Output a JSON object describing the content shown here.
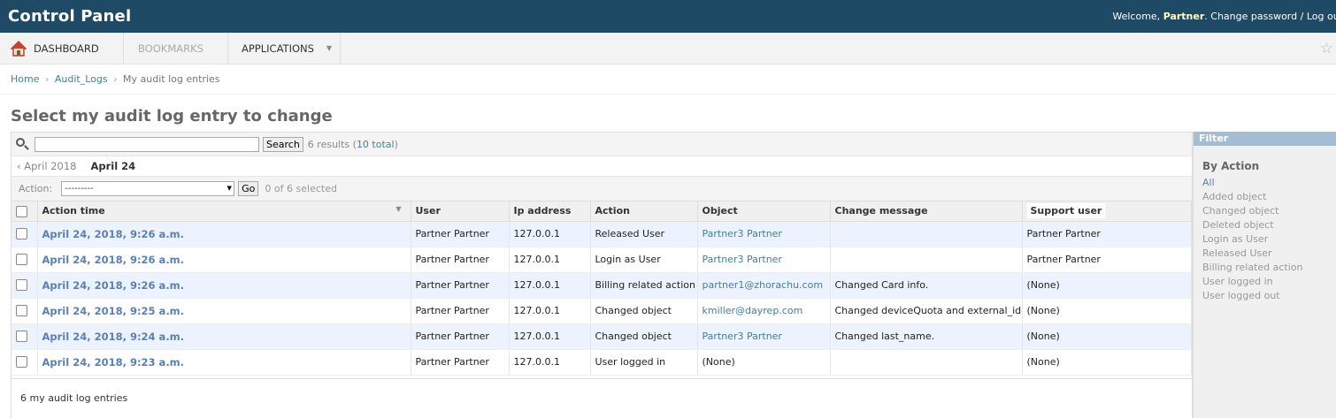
{
  "header": {
    "brand": "Control Panel",
    "welcome": "Welcome,",
    "username": "Partner",
    "change_password": "Change password",
    "separator": " / ",
    "logout": "Log out"
  },
  "nav": {
    "dashboard": "DASHBOARD",
    "bookmarks": "BOOKMARKS",
    "applications": "APPLICATIONS"
  },
  "breadcrumbs": {
    "home": "Home",
    "app": "Audit_Logs",
    "current": "My audit log entries",
    "sep": "›"
  },
  "page_title": "Select my audit log entry to change",
  "search": {
    "value": "",
    "button": "Search",
    "results_prefix": "6 results (",
    "total": "10 total",
    "results_suffix": ")"
  },
  "date_hierarchy": {
    "back": "‹ April 2018",
    "current": "April 24"
  },
  "actions": {
    "label": "Action:",
    "selected_option": "---------",
    "go": "Go",
    "selection_count": "0 of 6 selected"
  },
  "columns": [
    "Action time",
    "User",
    "Ip address",
    "Action",
    "Object",
    "Change message",
    "Support user"
  ],
  "rows": [
    {
      "time": "April 24, 2018, 9:26 a.m.",
      "user": "Partner Partner",
      "ip": "127.0.0.1",
      "action": "Released User",
      "object": "Partner3 Partner",
      "object_link": true,
      "message": "",
      "support": "Partner Partner"
    },
    {
      "time": "April 24, 2018, 9:26 a.m.",
      "user": "Partner Partner",
      "ip": "127.0.0.1",
      "action": "Login as User",
      "object": "Partner3 Partner",
      "object_link": true,
      "message": "",
      "support": "Partner Partner"
    },
    {
      "time": "April 24, 2018, 9:26 a.m.",
      "user": "Partner Partner",
      "ip": "127.0.0.1",
      "action": "Billing related action",
      "object": "partner1@zhorachu.com",
      "object_link": true,
      "message": "Changed Card info.",
      "support": "(None)"
    },
    {
      "time": "April 24, 2018, 9:25 a.m.",
      "user": "Partner Partner",
      "ip": "127.0.0.1",
      "action": "Changed object",
      "object": "kmiller@dayrep.com",
      "object_link": true,
      "message": "Changed deviceQuota and external_id.",
      "support": "(None)"
    },
    {
      "time": "April 24, 2018, 9:24 a.m.",
      "user": "Partner Partner",
      "ip": "127.0.0.1",
      "action": "Changed object",
      "object": "Partner3 Partner",
      "object_link": true,
      "message": "Changed last_name.",
      "support": "(None)"
    },
    {
      "time": "April 24, 2018, 9:23 a.m.",
      "user": "Partner Partner",
      "ip": "127.0.0.1",
      "action": "User logged in",
      "object": "(None)",
      "object_link": false,
      "message": "",
      "support": "(None)"
    }
  ],
  "paginator": "6 my audit log entries",
  "filter": {
    "title": "Filter",
    "group_title": "By Action",
    "options": [
      "All",
      "Added object",
      "Changed object",
      "Deleted object",
      "Login as User",
      "Released User",
      "Billing related action",
      "User logged in",
      "User logged out"
    ],
    "selected_index": 0
  },
  "colors": {
    "header_bg": "#1f4a66",
    "link": "#5b80b2",
    "row_alt": "#edf3fe",
    "filter_header": "#a4bdd3"
  },
  "icons": [
    "home-icon",
    "chevron-down-icon",
    "star-icon",
    "search-icon",
    "sort-desc-icon"
  ]
}
